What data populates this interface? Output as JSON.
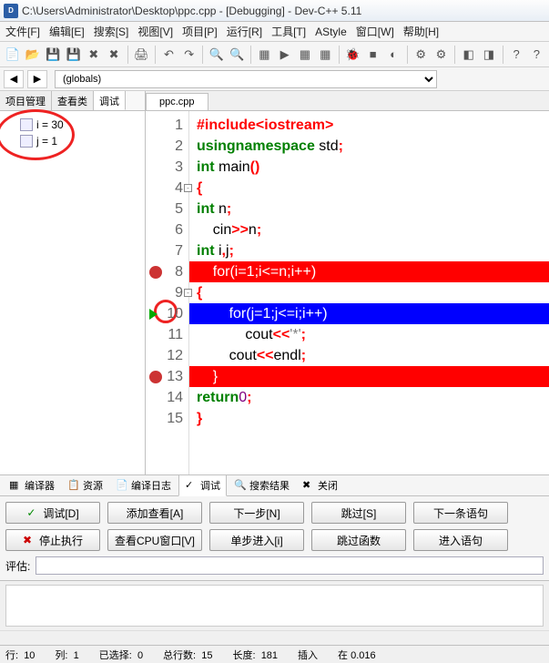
{
  "titlebar": {
    "path": "C:\\Users\\Administrator\\Desktop\\ppc.cpp - [Debugging] - Dev-C++ 5.11"
  },
  "menubar": [
    "文件[F]",
    "编辑[E]",
    "搜索[S]",
    "视图[V]",
    "项目[P]",
    "运行[R]",
    "工具[T]",
    "AStyle",
    "窗口[W]",
    "帮助[H]"
  ],
  "globals_combo": "(globals)",
  "left_tabs": {
    "items": [
      "项目管理",
      "查看类",
      "调试"
    ],
    "active": 2
  },
  "watches": [
    {
      "name": "i",
      "value": "30",
      "text": "i = 30"
    },
    {
      "name": "j",
      "value": "1",
      "text": "j = 1"
    }
  ],
  "file_tab": "ppc.cpp",
  "code_lines": [
    {
      "n": 1,
      "html": "<span class='op'>#include&lt;iostream&gt;</span>"
    },
    {
      "n": 2,
      "html": "<span class='kw'>using</span> <span class='kw'>namespace</span> std<span class='op'>;</span>"
    },
    {
      "n": 3,
      "html": "<span class='kw'>int</span> main<span class='op'>()</span>"
    },
    {
      "n": 4,
      "html": "<span class='op'>{</span>",
      "fold": true
    },
    {
      "n": 5,
      "html": "    <span class='kw'>int</span> n<span class='op'>;</span>"
    },
    {
      "n": 6,
      "html": "    cin<span class='op'>&gt;&gt;</span>n<span class='op'>;</span>"
    },
    {
      "n": 7,
      "html": "    <span class='kw'>int</span> i<span class='op'>,</span>j<span class='op'>;</span>"
    },
    {
      "n": 8,
      "html": "    for(i=1;i&lt;=n;i++)",
      "hl": "red",
      "bp": true
    },
    {
      "n": 9,
      "html": "    <span class='op'>{</span>",
      "fold": true
    },
    {
      "n": 10,
      "html": "        for(j=1;j&lt;=i;i++)",
      "hl": "blue",
      "cursor": true
    },
    {
      "n": 11,
      "html": "            cout<span class='op'>&lt;&lt;</span><span class='str'>'*'</span><span class='op'>;</span>"
    },
    {
      "n": 12,
      "html": "        cout<span class='op'>&lt;&lt;</span>endl<span class='op'>;</span>"
    },
    {
      "n": 13,
      "html": "    }",
      "hl": "red",
      "bp": true
    },
    {
      "n": 14,
      "html": "    <span class='kw'>return</span> <span class='num'>0</span><span class='op'>;</span>"
    },
    {
      "n": 15,
      "html": "<span class='op'>}</span>"
    }
  ],
  "bottom_tabs": {
    "items": [
      "编译器",
      "资源",
      "编译日志",
      "调试",
      "搜索结果",
      "关闭"
    ],
    "active": 3
  },
  "debug_buttons_row1": [
    "调试[D]",
    "添加查看[A]",
    "下一步[N]",
    "跳过[S]",
    "下一条语句"
  ],
  "debug_buttons_row2": [
    "停止执行",
    "查看CPU窗口[V]",
    "单步进入[i]",
    "跳过函数",
    "进入语句"
  ],
  "eval_label": "评估:",
  "statusbar": {
    "line_lbl": "行:",
    "line_val": "10",
    "col_lbl": "列:",
    "col_val": "1",
    "sel_lbl": "已选择:",
    "sel_val": "0",
    "total_lbl": "总行数:",
    "total_val": "15",
    "len_lbl": "长度:",
    "len_val": "181",
    "ins": "插入",
    "time_lbl": "在",
    "time_val": "0.016"
  }
}
